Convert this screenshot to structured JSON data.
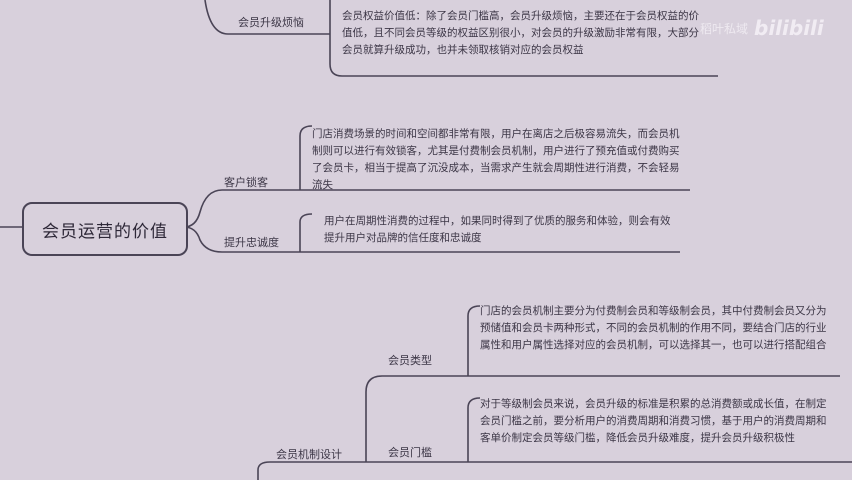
{
  "root": {
    "label": "会员运营的价值"
  },
  "watermark": {
    "channel": "稻叶私域",
    "platform": "bilibili"
  },
  "top_section": {
    "branch_label": "会员升级烦恼",
    "text": "会员权益价值低：除了会员门槛高，会员升级烦恼，主要还在于会员权益的价值低，且不同会员等级的权益区别很小，对会员的升级激励非常有限，大部分会员就算升级成功，也并未领取核销对应的会员权益"
  },
  "value_branches": [
    {
      "label": "客户锁客",
      "text": "门店消费场景的时间和空间都非常有限，用户在离店之后极容易流失，而会员机制则可以进行有效锁客，尤其是付费制会员机制，用户进行了预充值或付费购买了会员卡，相当于提高了沉没成本，当需求产生就会周期性进行消费，不会轻易流失"
    },
    {
      "label": "提升忠诚度",
      "text": "用户在周期性消费的过程中，如果同时得到了优质的服务和体验，则会有效提升用户对品牌的信任度和忠诚度"
    }
  ],
  "mechanism": {
    "label": "会员机制设计",
    "children": [
      {
        "label": "会员类型",
        "text": "门店的会员机制主要分为付费制会员和等级制会员，其中付费制会员又分为预储值和会员卡两种形式，不同的会员机制的作用不同，要结合门店的行业属性和用户属性选择对应的会员机制，可以选择其一，也可以进行搭配组合"
      },
      {
        "label": "会员门槛",
        "text": "对于等级制会员来说，会员升级的标准是积累的总消费额或成长值，在制定会员门槛之前，要分析用户的消费周期和消费习惯，基于用户的消费周期和客单价制定会员等级门槛，降低会员升级难度，提升会员升级积极性"
      }
    ]
  }
}
